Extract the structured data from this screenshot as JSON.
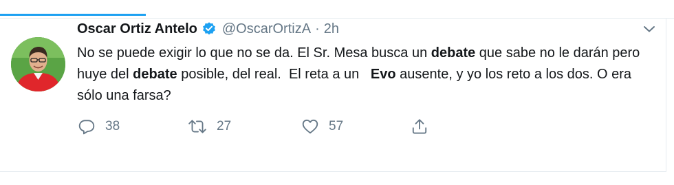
{
  "tweet": {
    "author_name": "Oscar Ortiz Antelo",
    "handle": "@OscarOrtizA",
    "separator": "·",
    "time": "2h",
    "text_parts": [
      {
        "text": "No se puede exigir lo que no se da. El Sr. Mesa busca un ",
        "bold": false
      },
      {
        "text": "debate",
        "bold": true
      },
      {
        "text": " que sabe no le darán pero huye del ",
        "bold": false
      },
      {
        "text": "debate",
        "bold": true
      },
      {
        "text": " posible, del real.  El reta a un   ",
        "bold": false
      },
      {
        "text": "Evo",
        "bold": true
      },
      {
        "text": " ausente, y yo los reto a los dos. O era sólo una farsa?",
        "bold": false
      }
    ],
    "replies": "38",
    "retweets": "27",
    "likes": "57"
  },
  "icons": {
    "verified": "verified-badge-icon",
    "caret": "chevron-down-icon",
    "reply": "reply-icon",
    "retweet": "retweet-icon",
    "like": "heart-icon",
    "share": "share-icon"
  },
  "colors": {
    "accent": "#1da1f2",
    "muted": "#657786",
    "text": "#14171a",
    "border": "#e6ecf0"
  }
}
